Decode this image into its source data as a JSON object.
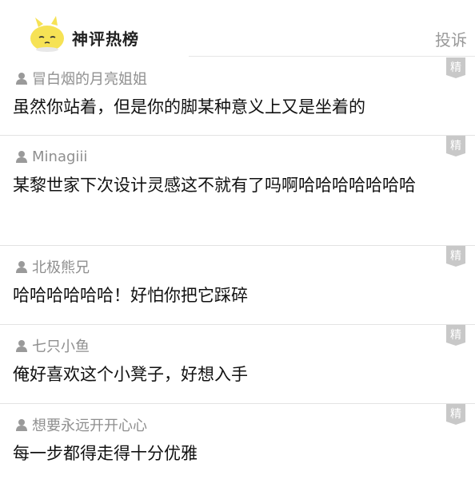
{
  "header": {
    "title": "神评热榜",
    "report_label": "投诉"
  },
  "colors": {
    "badge": "#c8c8c8",
    "mascot": "#f6e255"
  },
  "badge_label": "精",
  "comments": [
    {
      "user": "冒白烟的月亮姐姐",
      "text": "虽然你站着，但是你的脚某种意义上又是坐着的"
    },
    {
      "user": "Minagiii",
      "text": "某黎世家下次设计灵感这不就有了吗啊哈哈哈哈哈哈哈"
    },
    {
      "user": "北极熊兄",
      "text": "哈哈哈哈哈哈！好怕你把它踩碎"
    },
    {
      "user": "七只小鱼",
      "text": "俺好喜欢这个小凳子，好想入手"
    },
    {
      "user": "想要永远开开心心",
      "text": "每一步都得走得十分优雅"
    }
  ]
}
